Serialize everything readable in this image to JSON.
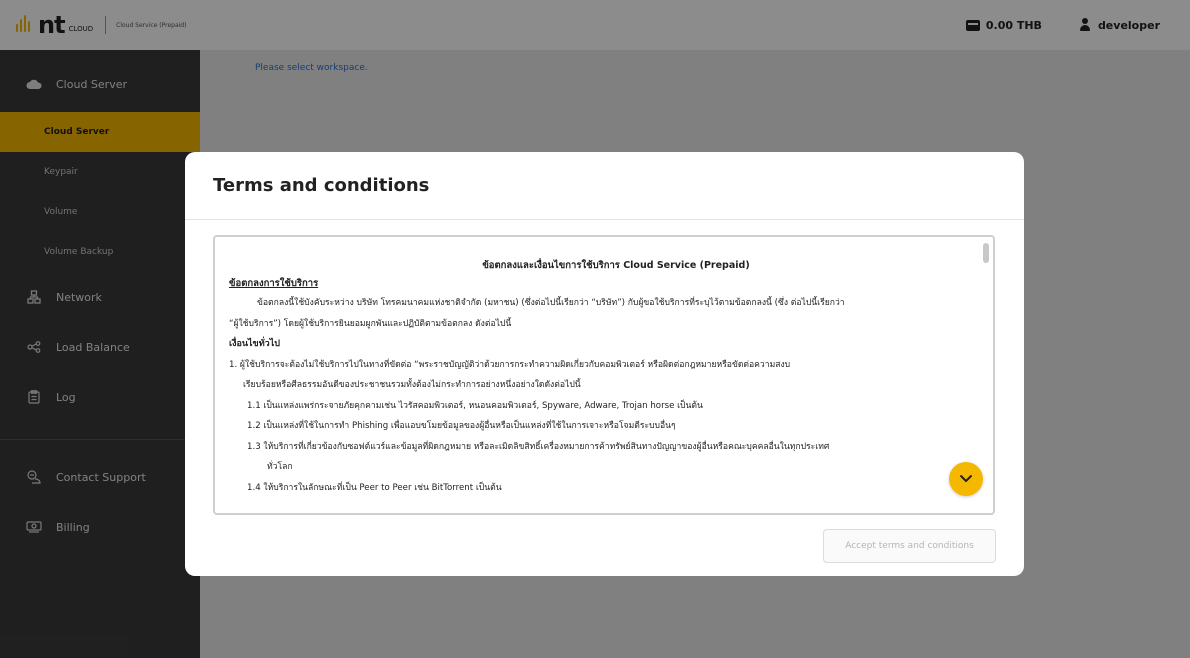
{
  "topbar": {
    "logo_text": "nt",
    "logo_cloud": "CLOUD",
    "logo_subtitle": "Cloud Service (Prepaid)",
    "balance": "0.00 THB",
    "username": "developer"
  },
  "sidebar": {
    "groups": [
      {
        "label": "Cloud Server",
        "icon": "cloud-icon"
      },
      {
        "label": "Network",
        "icon": "network-icon"
      },
      {
        "label": "Load Balance",
        "icon": "load-balance-icon"
      },
      {
        "label": "Log",
        "icon": "log-icon"
      },
      {
        "label": "Contact Support",
        "icon": "support-icon"
      },
      {
        "label": "Billing",
        "icon": "billing-icon"
      }
    ],
    "subitems": [
      {
        "label": "Cloud Server",
        "active": true
      },
      {
        "label": "Keypair"
      },
      {
        "label": "Volume"
      },
      {
        "label": "Volume Backup"
      }
    ]
  },
  "content": {
    "message": "Please select workspace."
  },
  "modal": {
    "title": "Terms and conditions",
    "doc_title": "ข้อตกลงและเงื่อนไขการใช้บริการ Cloud Service (Prepaid)",
    "section_title": "ข้อตกลงการใช้บริการ",
    "intro_1": "ข้อตกลงนี้ใช้บังคับระหว่าง บริษัท โทรคมนาคมแห่งชาติจำกัด (มหาชน) (ซึ่งต่อไปนี้เรียกว่า “บริษัท”) กับผู้ขอใช้บริการที่ระบุไว้ตามข้อตกลงนี้ (ซึ่ง ต่อไปนี้เรียกว่า",
    "intro_2": "“ผู้ใช้บริการ”) โดยผู้ใช้บริการยินยอมผูกพันและปฏิบัติตามข้อตกลง ดังต่อไปนี้",
    "general_title": "เงื่อนไขทั่วไป",
    "item_1a": "1.  ผู้ใช้บริการจะต้องไม่ใช้บริการไปในทางที่ขัดต่อ “พระราชบัญญัติว่าด้วยการกระทำความผิดเกี่ยวกับคอมพิวเตอร์ หรือผิดต่อกฎหมายหรือขัดต่อความสงบ",
    "item_1b": "เรียบร้อยหรือศีลธรรมอันดีของประชาชนรวมทั้งต้องไม่กระทำการอย่างหนึ่งอย่างใดดังต่อไปนี้",
    "sub_1_1": "1.1  เป็นแหล่งแพร่กระจายภัยคุกคามเช่น ไวรัสคอมพิวเตอร์, หนอนคอมพิวเตอร์, Spyware, Adware, Trojan horse เป็นต้น",
    "sub_1_2": "1.2  เป็นแหล่งที่ใช้ในการทำ Phishing เพื่อแอบขโมยข้อมูลของผู้อื่นหรือเป็นแหล่งที่ใช้ในการเจาะหรือโจมตีระบบอื่นๆ",
    "sub_1_3a": "1.3  ให้บริการที่เกี่ยวข้องกับซอฟต์แวร์และข้อมูลที่ผิดกฎหมาย หรือละเมิดลิขสิทธิ์เครื่องหมายการค้าทรัพย์สินทางปัญญาของผู้อื่นหรือคณะบุคคลอื่นในทุกประเทศ",
    "sub_1_3b": "ทั่วโลก",
    "sub_1_4": "1.4  ให้บริการในลักษณะที่เป็น Peer to Peer เช่น BitTorrent เป็นต้น",
    "accept_label": "Accept terms and conditions"
  },
  "colors": {
    "accent": "#f5b800",
    "sidebar_bg": "#3a3a3a",
    "link": "#2f6fd0"
  }
}
